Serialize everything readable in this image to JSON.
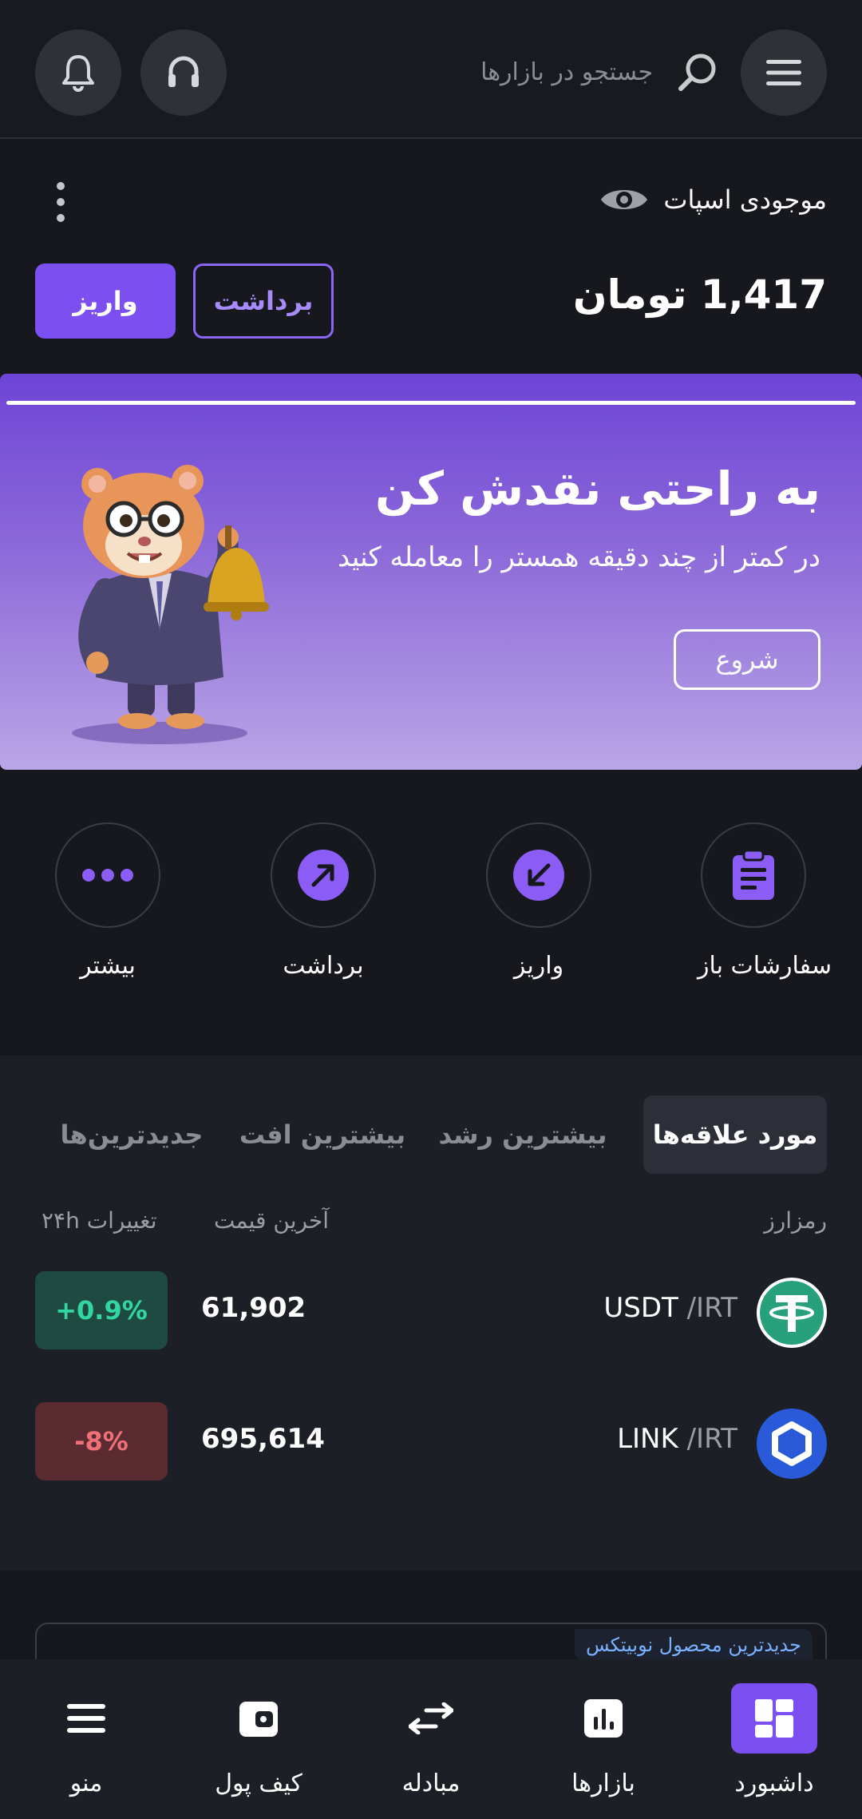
{
  "header": {
    "search_placeholder": "جستجو در بازارها",
    "icons": [
      "menu-icon",
      "search-icon",
      "headset-icon",
      "bell-icon"
    ]
  },
  "balance": {
    "label": "موجودی اسپات",
    "amount": "1,417 تومان",
    "deposit_label": "واریز",
    "withdraw_label": "برداشت"
  },
  "banner": {
    "title": "به راحتی نقدش کن",
    "subtitle": "در کمتر از چند دقیقه همستر را معامله کنید",
    "button_label": "شروع"
  },
  "quick_actions": [
    {
      "label": "سفارشات باز",
      "icon": "clipboard-icon"
    },
    {
      "label": "واریز",
      "icon": "arrow-down-left-icon"
    },
    {
      "label": "برداشت",
      "icon": "arrow-up-right-icon"
    },
    {
      "label": "بیشتر",
      "icon": "more-dots-icon"
    }
  ],
  "market": {
    "tabs": [
      "مورد علاقه‌ها",
      "بیشترین رشد",
      "بیشترین افت",
      "جدیدترین‌ها"
    ],
    "active_tab": 0,
    "columns": {
      "market": "رمزارز",
      "last_price": "آخرین قیمت",
      "change": "تغییرات ۲۴h"
    },
    "rows": [
      {
        "base": "USDT",
        "quote": " /IRT",
        "price": "61,902",
        "change": "+0.9%",
        "direction": "up",
        "icon_color": "#26a17b"
      },
      {
        "base": "LINK",
        "quote": " /IRT",
        "price": "695,614",
        "change": "-8%",
        "direction": "down",
        "icon_color": "#2a5ada"
      }
    ]
  },
  "product_card": {
    "tag": "جدیدترین محصول نوبیتکس"
  },
  "bottom_nav": [
    {
      "label": "داشبورد",
      "icon": "dashboard-icon",
      "active": true
    },
    {
      "label": "بازارها",
      "icon": "chart-icon",
      "active": false
    },
    {
      "label": "مبادله",
      "icon": "swap-icon",
      "active": false
    },
    {
      "label": "کیف پول",
      "icon": "wallet-icon",
      "active": false
    },
    {
      "label": "منو",
      "icon": "menu-icon",
      "active": false
    }
  ],
  "colors": {
    "accent": "#7b4ff0",
    "background": "#16181d",
    "up": "#33d6a0",
    "down": "#f0707a"
  }
}
